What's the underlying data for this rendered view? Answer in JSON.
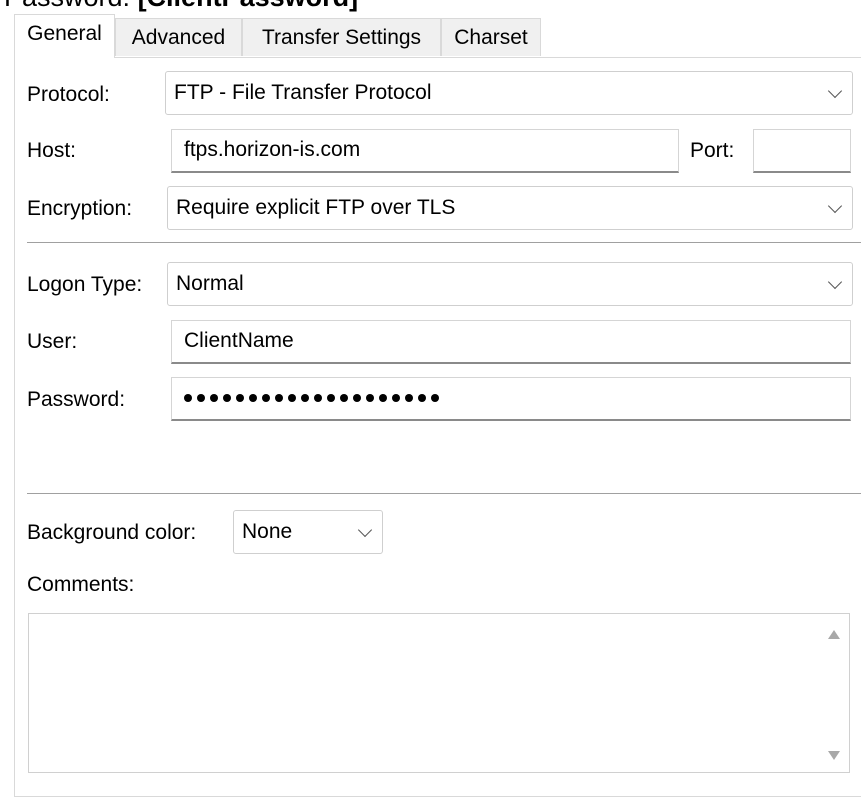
{
  "header_cut": {
    "prefix": "Password: ",
    "value": "[ClientPassword]"
  },
  "tabs": [
    {
      "label": "General",
      "active": true
    },
    {
      "label": "Advanced",
      "active": false
    },
    {
      "label": "Transfer Settings",
      "active": false
    },
    {
      "label": "Charset",
      "active": false
    }
  ],
  "form": {
    "protocol_label": "Protocol:",
    "protocol_value": "FTP - File Transfer Protocol",
    "host_label": "Host:",
    "host_value": "ftps.horizon-is.com",
    "port_label": "Port:",
    "port_value": "",
    "encryption_label": "Encryption:",
    "encryption_value": "Require explicit FTP over TLS",
    "logon_type_label": "Logon Type:",
    "logon_type_value": "Normal",
    "user_label": "User:",
    "user_value": "ClientName",
    "password_label": "Password:",
    "password_mask_count": 20,
    "bg_color_label": "Background color:",
    "bg_color_value": "None",
    "comments_label": "Comments:",
    "comments_value": ""
  },
  "icons": {
    "dropdown": "chevron-down-icon",
    "scroll_up": "scroll-up-arrow-icon",
    "scroll_down": "scroll-down-arrow-icon"
  },
  "colors": {
    "field_underline": "#8a8a8a",
    "tab_inactive_bg": "#f0f0f0",
    "separator": "#a0a0a0"
  }
}
